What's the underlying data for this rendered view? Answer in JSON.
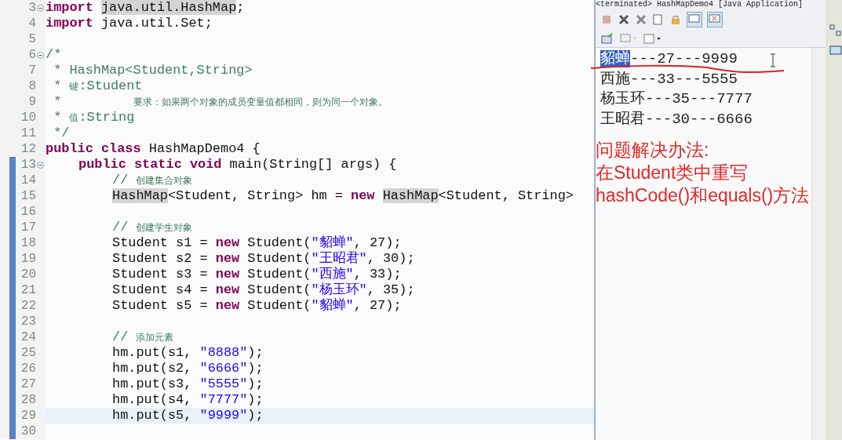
{
  "editor": {
    "lines": [
      {
        "number": "3",
        "foldable": true,
        "marked": false,
        "current": false,
        "kind": "top",
        "tokens": [
          {
            "kind": "kw",
            "t": "import "
          },
          {
            "kind": "occ",
            "t": "java.util.HashMap"
          },
          {
            "kind": "plain",
            "t": ";"
          }
        ]
      },
      {
        "number": "4",
        "foldable": false,
        "marked": false,
        "current": false,
        "kind": "top",
        "tokens": [
          {
            "kind": "kw",
            "t": "import "
          },
          {
            "kind": "plain",
            "t": "java.util.Set;"
          }
        ]
      },
      {
        "number": "5",
        "foldable": false,
        "marked": false,
        "current": false,
        "kind": "top"
      },
      {
        "number": "6",
        "foldable": true,
        "marked": false,
        "current": false,
        "kind": "top",
        "tokens": [
          {
            "kind": "comment",
            "t": "/*"
          }
        ]
      },
      {
        "number": "7",
        "foldable": false,
        "marked": false,
        "current": false,
        "kind": "top",
        "tokens": [
          {
            "kind": "comment",
            "t": " * HashMap<Student,String>"
          }
        ]
      },
      {
        "number": "8",
        "foldable": false,
        "marked": false,
        "current": false,
        "kind": "top",
        "tokens": [
          {
            "kind": "comment",
            "t": " * "
          },
          {
            "kind": "cjk",
            "t": "键"
          },
          {
            "kind": "comment",
            "t": ":Student"
          }
        ]
      },
      {
        "number": "9",
        "foldable": false,
        "marked": false,
        "current": false,
        "kind": "top",
        "tokens": [
          {
            "kind": "comment",
            "t": " *         "
          },
          {
            "kind": "cjk",
            "t": "要求：如果两个对象的成员变量值都相同，则为同一个对象。"
          }
        ]
      },
      {
        "number": "10",
        "foldable": false,
        "marked": false,
        "current": false,
        "kind": "top",
        "tokens": [
          {
            "kind": "comment",
            "t": " * "
          },
          {
            "kind": "cjk",
            "t": "值"
          },
          {
            "kind": "comment",
            "t": ":String"
          }
        ]
      },
      {
        "number": "11",
        "foldable": false,
        "marked": false,
        "current": false,
        "kind": "top",
        "tokens": [
          {
            "kind": "comment",
            "t": " */"
          }
        ]
      },
      {
        "number": "12",
        "foldable": false,
        "marked": false,
        "current": false,
        "kind": "top",
        "tokens": [
          {
            "kind": "kw",
            "t": "public class "
          },
          {
            "kind": "plain",
            "t": "HashMapDemo4 {"
          }
        ]
      },
      {
        "number": "13",
        "foldable": true,
        "marked": true,
        "current": false,
        "kind": "member",
        "tokens": [
          {
            "kind": "kw",
            "t": "public static void "
          },
          {
            "kind": "plain",
            "t": "main(String[] args) {"
          }
        ]
      },
      {
        "number": "14",
        "foldable": false,
        "marked": true,
        "current": false,
        "kind": "body",
        "tokens": [
          {
            "kind": "comment",
            "t": "// "
          },
          {
            "kind": "cjk",
            "t": "创建集合对象"
          }
        ]
      },
      {
        "number": "15",
        "foldable": false,
        "marked": true,
        "current": false,
        "kind": "body",
        "tokens": [
          {
            "kind": "occ",
            "t": "HashMap"
          },
          {
            "kind": "plain",
            "t": "<Student, String> hm = "
          },
          {
            "kind": "kw",
            "t": "new "
          },
          {
            "kind": "occ",
            "t": "HashMap"
          },
          {
            "kind": "plain",
            "t": "<Student, String>"
          }
        ]
      },
      {
        "number": "16",
        "foldable": false,
        "marked": true,
        "current": false,
        "kind": "body"
      },
      {
        "number": "17",
        "foldable": false,
        "marked": true,
        "current": false,
        "kind": "body",
        "tokens": [
          {
            "kind": "comment",
            "t": "// "
          },
          {
            "kind": "cjk",
            "t": "创建学生对象"
          }
        ]
      },
      {
        "number": "18",
        "foldable": false,
        "marked": true,
        "current": false,
        "kind": "body",
        "tokens": [
          {
            "kind": "plain",
            "t": "Student s1 = "
          },
          {
            "kind": "kw",
            "t": "new "
          },
          {
            "kind": "plain",
            "t": "Student("
          },
          {
            "kind": "str",
            "t": "\"貂蝉\""
          },
          {
            "kind": "plain",
            "t": ", 27);"
          }
        ]
      },
      {
        "number": "19",
        "foldable": false,
        "marked": true,
        "current": false,
        "kind": "body",
        "tokens": [
          {
            "kind": "plain",
            "t": "Student s2 = "
          },
          {
            "kind": "kw",
            "t": "new "
          },
          {
            "kind": "plain",
            "t": "Student("
          },
          {
            "kind": "str",
            "t": "\"王昭君\""
          },
          {
            "kind": "plain",
            "t": ", 30);"
          }
        ]
      },
      {
        "number": "20",
        "foldable": false,
        "marked": true,
        "current": false,
        "kind": "body",
        "tokens": [
          {
            "kind": "plain",
            "t": "Student s3 = "
          },
          {
            "kind": "kw",
            "t": "new "
          },
          {
            "kind": "plain",
            "t": "Student("
          },
          {
            "kind": "str",
            "t": "\"西施\""
          },
          {
            "kind": "plain",
            "t": ", 33);"
          }
        ]
      },
      {
        "number": "21",
        "foldable": false,
        "marked": true,
        "current": false,
        "kind": "body",
        "tokens": [
          {
            "kind": "plain",
            "t": "Student s4 = "
          },
          {
            "kind": "kw",
            "t": "new "
          },
          {
            "kind": "plain",
            "t": "Student("
          },
          {
            "kind": "str",
            "t": "\"杨玉环\""
          },
          {
            "kind": "plain",
            "t": ", 35);"
          }
        ]
      },
      {
        "number": "22",
        "foldable": false,
        "marked": true,
        "current": false,
        "kind": "body",
        "tokens": [
          {
            "kind": "plain",
            "t": "Student s5 = "
          },
          {
            "kind": "kw",
            "t": "new "
          },
          {
            "kind": "plain",
            "t": "Student("
          },
          {
            "kind": "str",
            "t": "\"貂蝉\""
          },
          {
            "kind": "plain",
            "t": ", 27);"
          }
        ]
      },
      {
        "number": "23",
        "foldable": false,
        "marked": true,
        "current": false,
        "kind": "body"
      },
      {
        "number": "24",
        "foldable": false,
        "marked": true,
        "current": false,
        "kind": "body",
        "tokens": [
          {
            "kind": "comment",
            "t": "// "
          },
          {
            "kind": "cjk",
            "t": "添加元素"
          }
        ]
      },
      {
        "number": "25",
        "foldable": false,
        "marked": true,
        "current": false,
        "kind": "body",
        "tokens": [
          {
            "kind": "plain",
            "t": "hm.put(s1, "
          },
          {
            "kind": "str",
            "t": "\"8888\""
          },
          {
            "kind": "plain",
            "t": ");"
          }
        ]
      },
      {
        "number": "26",
        "foldable": false,
        "marked": true,
        "current": false,
        "kind": "body",
        "tokens": [
          {
            "kind": "plain",
            "t": "hm.put(s2, "
          },
          {
            "kind": "str",
            "t": "\"6666\""
          },
          {
            "kind": "plain",
            "t": ");"
          }
        ]
      },
      {
        "number": "27",
        "foldable": false,
        "marked": true,
        "current": false,
        "kind": "body",
        "tokens": [
          {
            "kind": "plain",
            "t": "hm.put(s3, "
          },
          {
            "kind": "str",
            "t": "\"5555\""
          },
          {
            "kind": "plain",
            "t": ");"
          }
        ]
      },
      {
        "number": "28",
        "foldable": false,
        "marked": true,
        "current": false,
        "kind": "body",
        "tokens": [
          {
            "kind": "plain",
            "t": "hm.put(s4, "
          },
          {
            "kind": "str",
            "t": "\"7777\""
          },
          {
            "kind": "plain",
            "t": ");"
          }
        ]
      },
      {
        "number": "29",
        "foldable": false,
        "marked": true,
        "current": true,
        "kind": "body",
        "tokens": [
          {
            "kind": "plain",
            "t": "hm.put(s5, "
          },
          {
            "kind": "str",
            "t": "\"9999\""
          },
          {
            "kind": "plain",
            "t": ");"
          }
        ]
      },
      {
        "number": "30",
        "foldable": false,
        "marked": true,
        "current": false,
        "kind": "body"
      }
    ]
  },
  "console": {
    "title": "<terminated> HashMapDemo4 [Java Application]",
    "output": [
      [
        {
          "t": "貂蝉",
          "selected": true
        },
        {
          "t": "---27---9999",
          "selected": false
        }
      ],
      [
        {
          "t": "西施---33---5555",
          "selected": false
        }
      ],
      [
        {
          "t": "杨玉环---35---7777",
          "selected": false
        }
      ],
      [
        {
          "t": "王昭君---30---6666",
          "selected": false
        }
      ]
    ],
    "note": [
      "问题解决办法:",
      "在Student类中重写",
      "hashCode()和equals()方法"
    ]
  }
}
